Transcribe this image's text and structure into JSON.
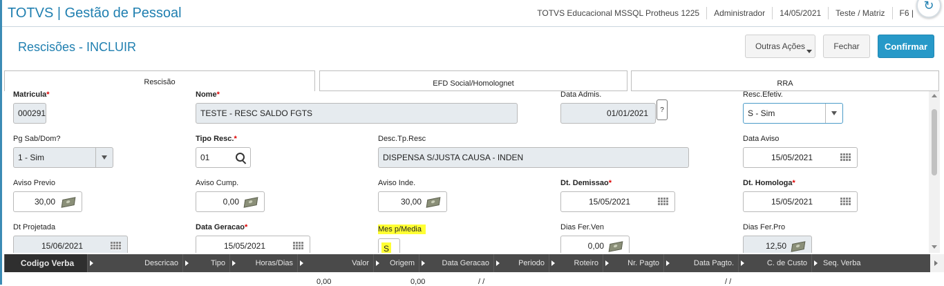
{
  "header": {
    "title": "TOTVS | Gestão de Pessoal",
    "environment": "TOTVS Educacional MSSQL Protheus 1225",
    "user": "Administrador",
    "date": "14/05/2021",
    "company": "Teste / Matriz",
    "shortcut": "F6 |"
  },
  "page": {
    "title": "Rescisões - INCLUIR",
    "buttons": {
      "outras": "Outras Ações",
      "fechar": "Fechar",
      "confirmar": "Confirmar"
    }
  },
  "tabs": [
    "Rescisão",
    "EFD Social/Homolognet",
    "RRA"
  ],
  "form": {
    "matricula": {
      "label": "Matricula",
      "value": "000291"
    },
    "nome": {
      "label": "Nome",
      "value": "TESTE - RESC SALDO FGTS"
    },
    "data_admis": {
      "label": "Data Admis.",
      "value": "01/01/2021",
      "help": "?"
    },
    "resc_efetiv": {
      "label": "Resc.Efetiv.",
      "value": "S - Sim"
    },
    "pg_sab_dom": {
      "label": "Pg Sab/Dom?",
      "value": "1 - Sim"
    },
    "tipo_resc": {
      "label": "Tipo Resc.",
      "value": "01"
    },
    "desc_tp_resc": {
      "label": "Desc.Tp.Resc",
      "value": "DISPENSA S/JUSTA CAUSA - INDEN"
    },
    "data_aviso": {
      "label": "Data Aviso",
      "value": "15/05/2021"
    },
    "aviso_previo": {
      "label": "Aviso Previo",
      "value": "30,00"
    },
    "aviso_cump": {
      "label": "Aviso Cump.",
      "value": "0,00"
    },
    "aviso_inde": {
      "label": "Aviso Inde.",
      "value": "30,00"
    },
    "dt_demissao": {
      "label": "Dt. Demissao",
      "value": "15/05/2021"
    },
    "dt_homologa": {
      "label": "Dt. Homologa",
      "value": "15/05/2021"
    },
    "dt_projetada": {
      "label": "Dt Projetada",
      "value": "15/06/2021"
    },
    "data_geracao": {
      "label": "Data Geracao",
      "value": "15/05/2021"
    },
    "mes_media": {
      "label": "Mes p/Media",
      "value": "S"
    },
    "dias_fer_ven": {
      "label": "Dias Fer.Ven",
      "value": "0,00"
    },
    "dias_fer_pro": {
      "label": "Dias Fer.Pro",
      "value": "12,50"
    },
    "required_mark": "*"
  },
  "grid": {
    "columns": [
      "Codigo Verba",
      "Descricao",
      "Tipo",
      "Horas/Dias",
      "Valor",
      "Origem",
      "Data Geracao",
      "Periodo",
      "Roteiro",
      "Nr. Pagto",
      "Data Pagto.",
      "C. de Custo",
      "Seq. Verba"
    ],
    "row": {
      "horas": "0,00",
      "valor": "0,00",
      "data_geracao": "/ /",
      "data_pagto": "/ /"
    }
  },
  "colors": {
    "accent": "#2799c8",
    "title": "#1f7fb0",
    "highlight": "#ffff33",
    "grid_header": "#4a4a4a"
  }
}
